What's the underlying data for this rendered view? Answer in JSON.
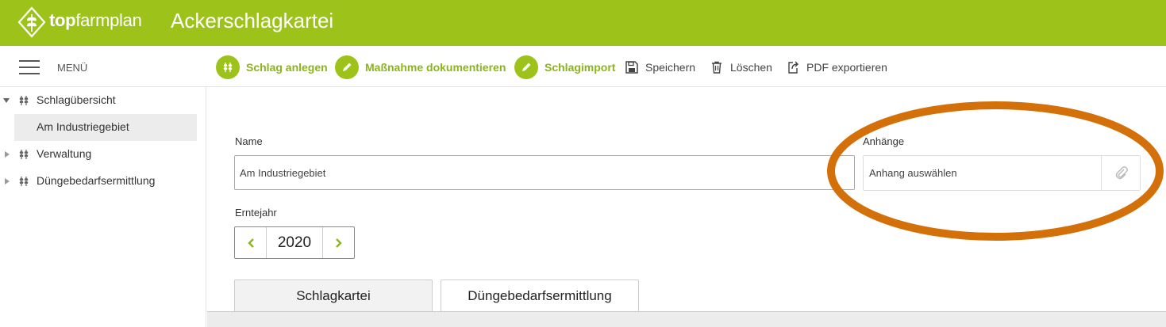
{
  "header": {
    "brand_bold": "top",
    "brand_rest": "farmplan",
    "title": "Ackerschlagkartei",
    "color": "#9dc31a"
  },
  "toolbar": {
    "menu_label": "MENÜ",
    "buttons": [
      {
        "label": "Schlag anlegen",
        "icon": "wheat-icon"
      },
      {
        "label": "Maßnahme dokumentieren",
        "icon": "pencil-icon"
      },
      {
        "label": "Schlagimport",
        "icon": "pencil-icon"
      },
      {
        "label": "Speichern",
        "icon": "save-icon"
      },
      {
        "label": "Löschen",
        "icon": "trash-icon"
      },
      {
        "label": "PDF exportieren",
        "icon": "export-icon"
      }
    ]
  },
  "sidebar": {
    "items": [
      {
        "label": "Schlagübersicht",
        "expanded": true
      },
      {
        "label": "Am Industriegebiet",
        "selected": true
      },
      {
        "label": "Verwaltung",
        "expanded": false
      },
      {
        "label": "Düngebedarfsermittlung",
        "expanded": false
      }
    ]
  },
  "form": {
    "name_label": "Name",
    "name_value": "Am Industriegebiet",
    "attachments_label": "Anhänge",
    "attachments_placeholder": "Anhang auswählen",
    "year_label": "Erntejahr",
    "year_value": "2020"
  },
  "tabs": [
    {
      "label": "Schlagkartei",
      "active": true
    },
    {
      "label": "Düngebedarfsermittlung",
      "active": false
    }
  ],
  "annotation_color": "#d4700a"
}
